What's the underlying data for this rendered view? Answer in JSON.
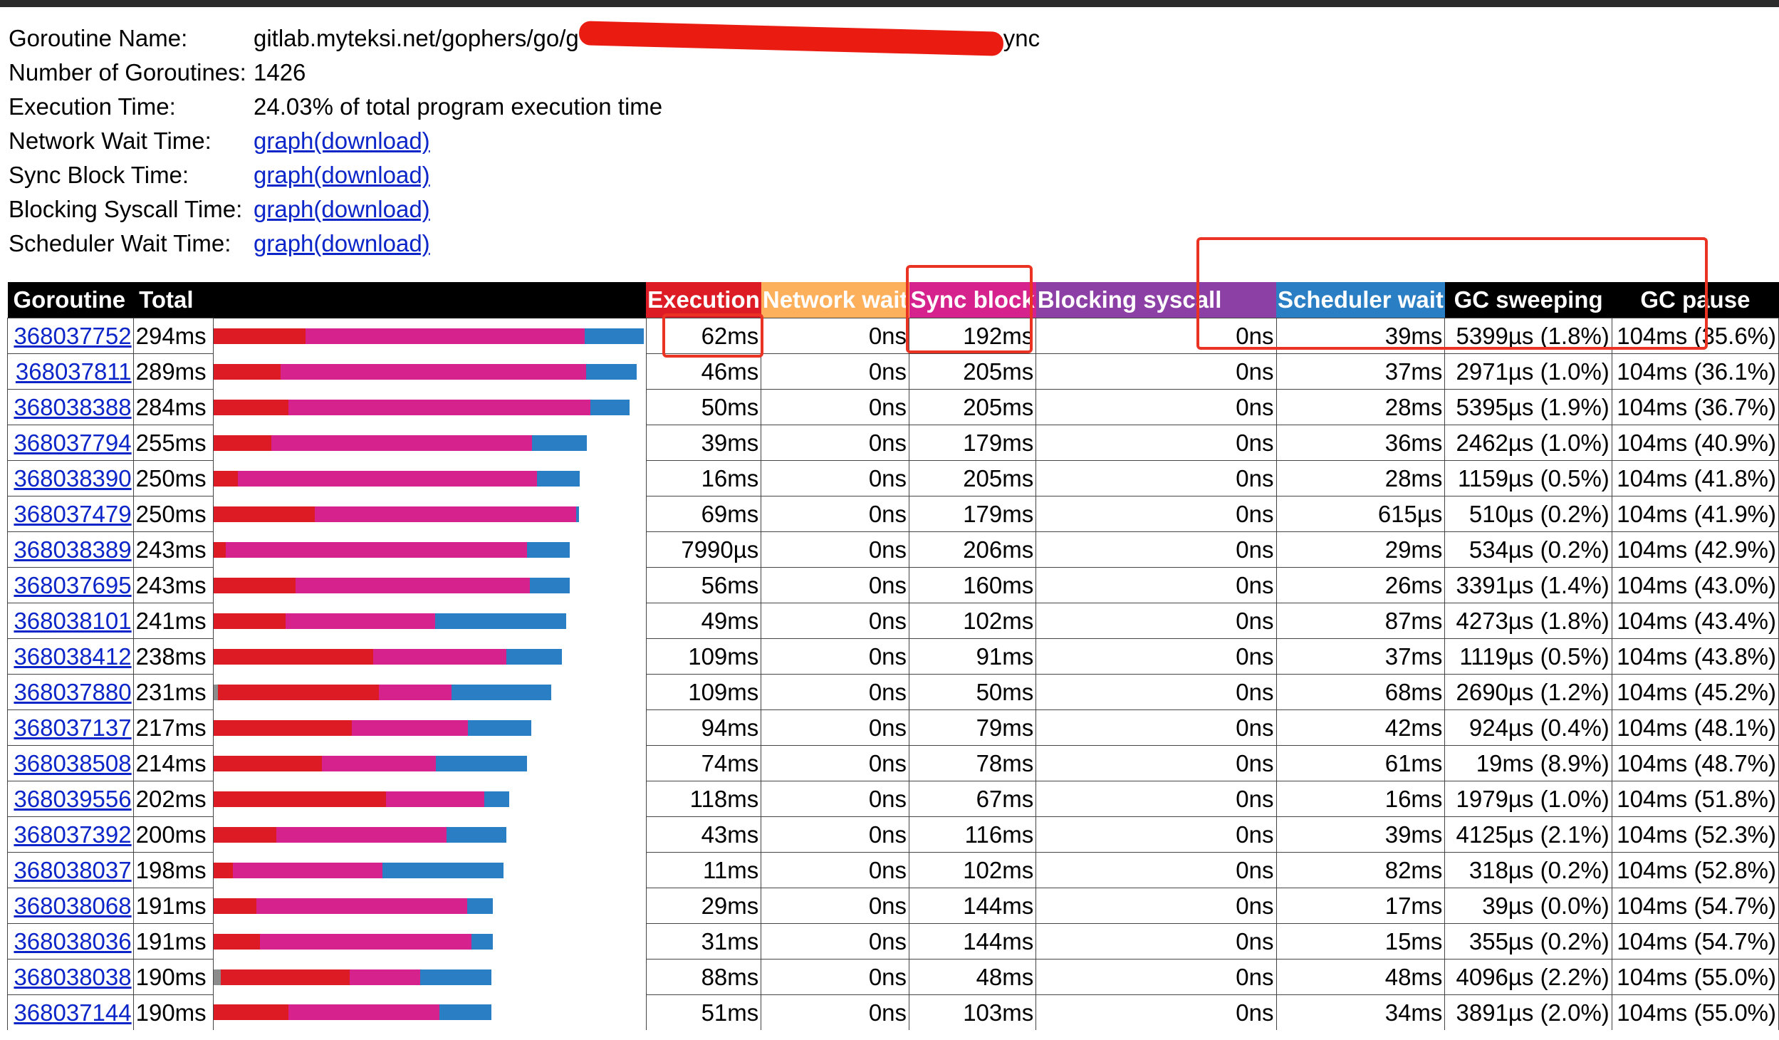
{
  "summary": [
    {
      "label": "Goroutine Name:",
      "name_start": "gitlab.myteksi.net/gophers/go/g",
      "name_end": "ync",
      "redacted": true
    },
    {
      "label": "Number of Goroutines:",
      "value": "1426"
    },
    {
      "label": "Execution Time:",
      "value": "24.03% of total program execution time"
    },
    {
      "label": "Network Wait Time:",
      "link": "graph(download)"
    },
    {
      "label": "Sync Block Time:",
      "link": "graph(download)"
    },
    {
      "label": "Blocking Syscall Time:",
      "link": "graph(download)"
    },
    {
      "label": "Scheduler Wait Time:",
      "link": "graph(download)"
    }
  ],
  "columns": {
    "goroutine": "Goroutine",
    "total": "Total",
    "execution": "Execution",
    "network": "Network wait",
    "sync": "Sync block",
    "syscall": "Blocking syscall",
    "sched": "Scheduler wait",
    "gcsweep": "GC sweeping",
    "gcpause": "GC pause"
  },
  "colors": {
    "execution": "#dd1b24",
    "network": "#fcb05c",
    "sync": "#d6228d",
    "syscall": "#8c3fa4",
    "sched": "#2a7ec3",
    "gcsweep": "#000000",
    "gcpause": "#000000",
    "other": "#8c8c8c"
  },
  "rows": [
    {
      "id": "368037752",
      "total": "294ms",
      "exec": "62ms",
      "net": "0ns",
      "sync": "192ms",
      "sys": "0ns",
      "sched": "39ms",
      "gcsweep": "5399µs (1.8%)",
      "gcpause": "104ms (35.6%)",
      "b": [
        0,
        0.213,
        0.862,
        1.0
      ]
    },
    {
      "id": "368037811",
      "total": "289ms",
      "exec": "46ms",
      "net": "0ns",
      "sync": "205ms",
      "sys": "0ns",
      "sched": "37ms",
      "gcsweep": "2971µs (1.0%)",
      "gcpause": "104ms (36.1%)",
      "b": [
        0,
        0.155,
        0.865,
        0.983
      ]
    },
    {
      "id": "368038388",
      "total": "284ms",
      "exec": "50ms",
      "net": "0ns",
      "sync": "205ms",
      "sys": "0ns",
      "sched": "28ms",
      "gcsweep": "5395µs (1.9%)",
      "gcpause": "104ms (36.7%)",
      "b": [
        0,
        0.173,
        0.875,
        0.966
      ]
    },
    {
      "id": "368037794",
      "total": "255ms",
      "exec": "39ms",
      "net": "0ns",
      "sync": "179ms",
      "sys": "0ns",
      "sched": "36ms",
      "gcsweep": "2462µs (1.0%)",
      "gcpause": "104ms (40.9%)",
      "b": [
        0,
        0.133,
        0.74,
        0.867
      ]
    },
    {
      "id": "368038390",
      "total": "250ms",
      "exec": "16ms",
      "net": "0ns",
      "sync": "205ms",
      "sys": "0ns",
      "sched": "28ms",
      "gcsweep": "1159µs (0.5%)",
      "gcpause": "104ms (41.8%)",
      "b": [
        0,
        0.056,
        0.752,
        0.85
      ]
    },
    {
      "id": "368037479",
      "total": "250ms",
      "exec": "69ms",
      "net": "0ns",
      "sync": "179ms",
      "sys": "0ns",
      "sched": "615µs",
      "gcsweep": "510µs (0.2%)",
      "gcpause": "104ms (41.9%)",
      "b": [
        0,
        0.234,
        0.842,
        0.85
      ]
    },
    {
      "id": "368038389",
      "total": "243ms",
      "exec": "7990µs",
      "net": "0ns",
      "sync": "206ms",
      "sys": "0ns",
      "sched": "29ms",
      "gcsweep": "534µs (0.2%)",
      "gcpause": "104ms (42.9%)",
      "b": [
        0,
        0.027,
        0.728,
        0.827
      ]
    },
    {
      "id": "368037695",
      "total": "243ms",
      "exec": "56ms",
      "net": "0ns",
      "sync": "160ms",
      "sys": "0ns",
      "sched": "26ms",
      "gcsweep": "3391µs (1.4%)",
      "gcpause": "104ms (43.0%)",
      "b": [
        0,
        0.19,
        0.734,
        0.827
      ]
    },
    {
      "id": "368038101",
      "total": "241ms",
      "exec": "49ms",
      "net": "0ns",
      "sync": "102ms",
      "sys": "0ns",
      "sched": "87ms",
      "gcsweep": "4273µs (1.8%)",
      "gcpause": "104ms (43.4%)",
      "b": [
        0,
        0.167,
        0.514,
        0.82
      ]
    },
    {
      "id": "368038412",
      "total": "238ms",
      "exec": "109ms",
      "net": "0ns",
      "sync": "91ms",
      "sys": "0ns",
      "sched": "37ms",
      "gcsweep": "1119µs (0.5%)",
      "gcpause": "104ms (43.8%)",
      "b": [
        0,
        0.371,
        0.68,
        0.81
      ]
    },
    {
      "id": "368037880",
      "total": "231ms",
      "exec": "109ms",
      "net": "0ns",
      "sync": "50ms",
      "sys": "0ns",
      "sched": "68ms",
      "gcsweep": "2690µs (1.2%)",
      "gcpause": "104ms (45.2%)",
      "b": [
        0.01,
        0.383,
        0.553,
        0.785
      ]
    },
    {
      "id": "368037137",
      "total": "217ms",
      "exec": "94ms",
      "net": "0ns",
      "sync": "79ms",
      "sys": "0ns",
      "sched": "42ms",
      "gcsweep": "924µs (0.4%)",
      "gcpause": "104ms (48.1%)",
      "b": [
        0,
        0.32,
        0.59,
        0.738
      ]
    },
    {
      "id": "368038508",
      "total": "214ms",
      "exec": "74ms",
      "net": "0ns",
      "sync": "78ms",
      "sys": "0ns",
      "sched": "61ms",
      "gcsweep": "19ms (8.9%)",
      "gcpause": "104ms (48.7%)",
      "b": [
        0,
        0.252,
        0.517,
        0.728
      ]
    },
    {
      "id": "368039556",
      "total": "202ms",
      "exec": "118ms",
      "net": "0ns",
      "sync": "67ms",
      "sys": "0ns",
      "sched": "16ms",
      "gcsweep": "1979µs (1.0%)",
      "gcpause": "104ms (51.8%)",
      "b": [
        0,
        0.401,
        0.629,
        0.687
      ]
    },
    {
      "id": "368037392",
      "total": "200ms",
      "exec": "43ms",
      "net": "0ns",
      "sync": "116ms",
      "sys": "0ns",
      "sched": "39ms",
      "gcsweep": "4125µs (2.1%)",
      "gcpause": "104ms (52.3%)",
      "b": [
        0,
        0.146,
        0.541,
        0.68
      ]
    },
    {
      "id": "368038037",
      "total": "198ms",
      "exec": "11ms",
      "net": "0ns",
      "sync": "102ms",
      "sys": "0ns",
      "sched": "82ms",
      "gcsweep": "318µs (0.2%)",
      "gcpause": "104ms (52.8%)",
      "b": [
        0,
        0.045,
        0.392,
        0.673
      ]
    },
    {
      "id": "368038068",
      "total": "191ms",
      "exec": "29ms",
      "net": "0ns",
      "sync": "144ms",
      "sys": "0ns",
      "sched": "17ms",
      "gcsweep": "39µs (0.0%)",
      "gcpause": "104ms (54.7%)",
      "b": [
        0,
        0.099,
        0.589,
        0.649
      ]
    },
    {
      "id": "368038036",
      "total": "191ms",
      "exec": "31ms",
      "net": "0ns",
      "sync": "144ms",
      "sys": "0ns",
      "sched": "15ms",
      "gcsweep": "355µs (0.2%)",
      "gcpause": "104ms (54.7%)",
      "b": [
        0,
        0.107,
        0.599,
        0.649
      ]
    },
    {
      "id": "368038038",
      "total": "190ms",
      "exec": "88ms",
      "net": "0ns",
      "sync": "48ms",
      "sys": "0ns",
      "sched": "48ms",
      "gcsweep": "4096µs (2.2%)",
      "gcpause": "104ms (55.0%)",
      "b": [
        0.016,
        0.316,
        0.48,
        0.646
      ]
    },
    {
      "id": "368037144",
      "total": "190ms",
      "exec": "51ms",
      "net": "0ns",
      "sync": "103ms",
      "sys": "0ns",
      "sched": "34ms",
      "gcsweep": "3891µs (2.0%)",
      "gcpause": "104ms (55.0%)",
      "b": [
        0,
        0.173,
        0.524,
        0.646
      ]
    }
  ]
}
